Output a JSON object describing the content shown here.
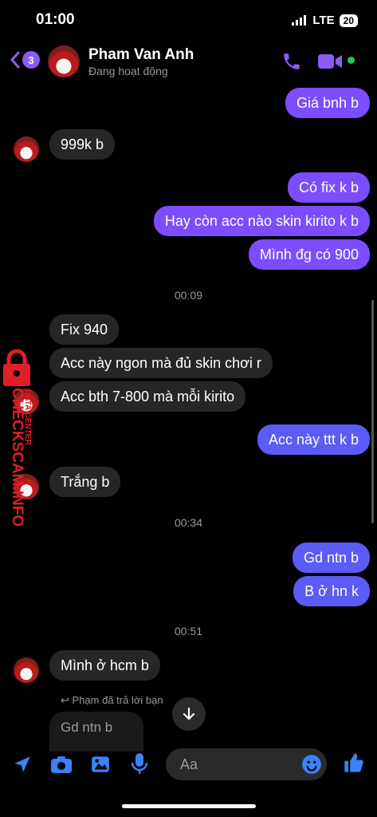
{
  "status_bar": {
    "time": "01:00",
    "network": "LTE",
    "battery": "20"
  },
  "header": {
    "unread_count": "3",
    "name": "Pham Van Anh",
    "status": "Đang hoạt động"
  },
  "messages": [
    {
      "text": "Giá bnh b"
    },
    {
      "text": "999k b"
    },
    {
      "text": "Có fix k b"
    },
    {
      "text": "Hay còn acc nào skin kirito k b"
    },
    {
      "text": "Mình đg có 900"
    },
    {
      "text": "Fix 940"
    },
    {
      "text": "Acc này ngon mà đủ skin chơi r"
    },
    {
      "text": "Acc bth 7-800 mà mỗi kirito"
    },
    {
      "text": "Acc này ttt k b"
    },
    {
      "text": "Trắng b"
    },
    {
      "text": "Gd ntn b"
    },
    {
      "text": "B ở hn k"
    },
    {
      "text": "Mình ở hcm b"
    }
  ],
  "timestamps": [
    "00:09",
    "00:34",
    "00:51"
  ],
  "reply": {
    "note": "Phạm đã trả lời bạn",
    "quoted": "Gd ntn b"
  },
  "composer": {
    "placeholder": "Aa"
  },
  "watermark": {
    "brand": "CHECKSCAM.INFO",
    "sub": "DATA CENTER"
  },
  "colors": {
    "accent": "#8b5cf6",
    "outgoing": "#7c4dff",
    "incoming": "#262626",
    "online": "#22c55e"
  }
}
